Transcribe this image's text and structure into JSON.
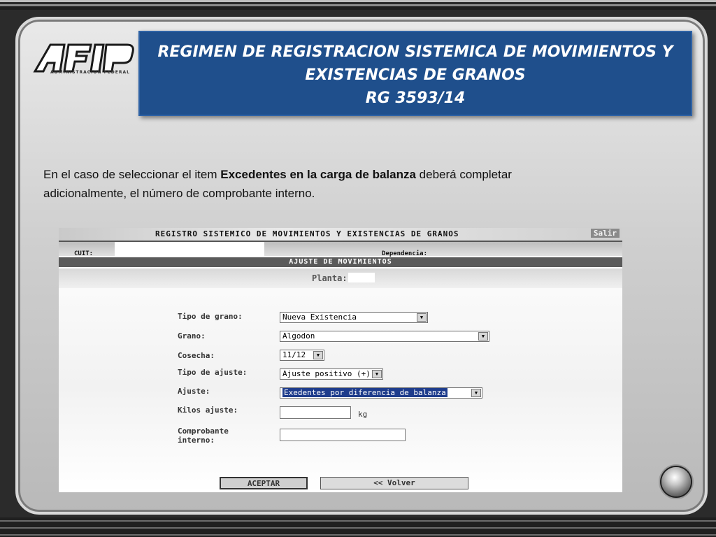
{
  "logo": {
    "name": "AFIP",
    "subtitle": "ADMINISTRACION FEDERAL"
  },
  "slide": {
    "title_line1": "REGIMEN DE REGISTRACION SISTEMICA DE MOVIMIENTOS Y",
    "title_line2": "EXISTENCIAS DE GRANOS",
    "title_line3": "RG  3593/14",
    "desc_part1": "En el caso de seleccionar el item ",
    "desc_bold": "Excedentes en la carga de balanza",
    "desc_part2": " deberá completar",
    "desc_line2": "adicionalmente, el número de comprobante interno."
  },
  "app": {
    "header_title": "REGISTRO SISTEMICO DE MOVIMIENTOS Y EXISTENCIAS DE GRANOS",
    "salir": "Salir",
    "cuit_label": "CUIT:",
    "dependencia_label": "Dependencia:",
    "section_title": "AJUSTE DE MOVIMIENTOS",
    "planta_label": "Planta:",
    "fields": {
      "tipo_grano": {
        "label": "Tipo de grano:",
        "value": "Nueva Existencia"
      },
      "grano": {
        "label": "Grano:",
        "value": "Algodon"
      },
      "cosecha": {
        "label": "Cosecha:",
        "value": "11/12"
      },
      "tipo_ajuste": {
        "label": "Tipo de ajuste:",
        "value": "Ajuste positivo (+)"
      },
      "ajuste": {
        "label": "Ajuste:",
        "value": "Exedentes por diferencia de balanza"
      },
      "kilos": {
        "label": "Kilos ajuste:",
        "value": "",
        "unit": "kg"
      },
      "comprobante": {
        "label_line1": "Comprobante",
        "label_line2": "interno:",
        "value": ""
      }
    },
    "btn_accept": "ACEPTAR",
    "btn_back": "<< Volver"
  }
}
